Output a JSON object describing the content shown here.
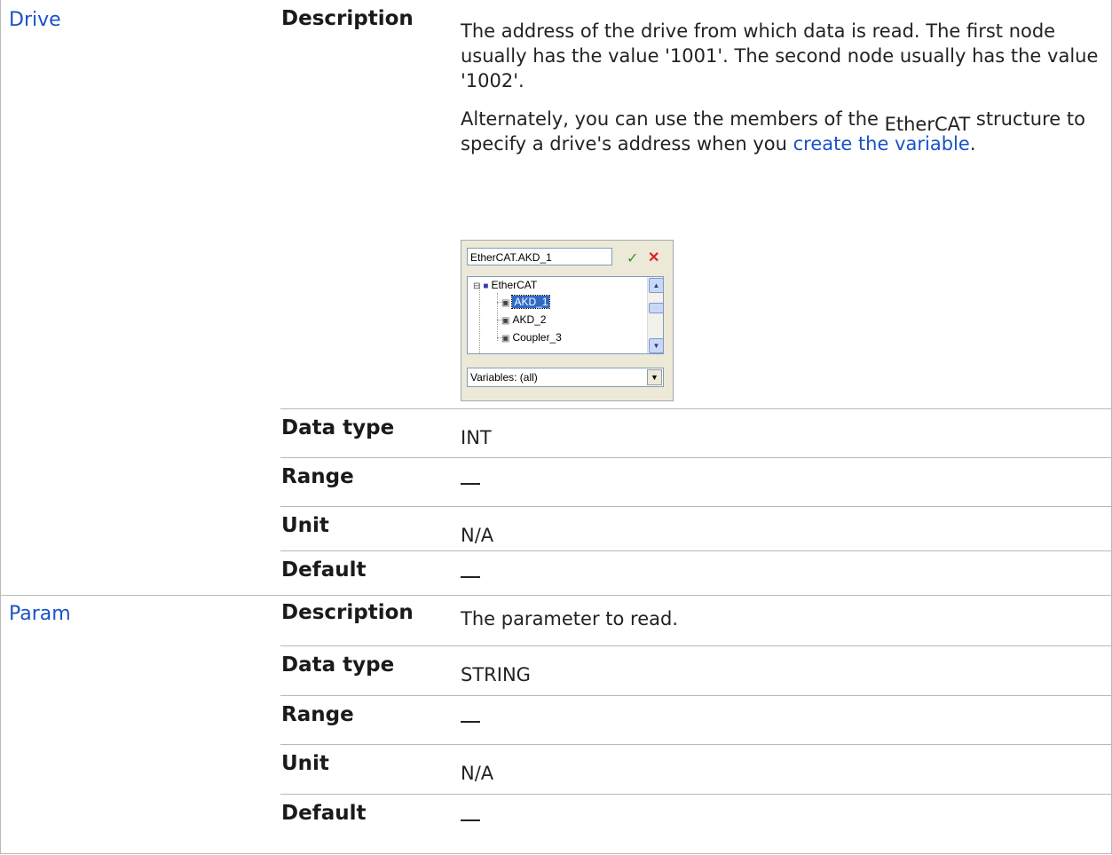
{
  "parameters": [
    {
      "name": "Drive",
      "description_label": "Description",
      "description_p1": "The address of the drive from which data is read. The first node usually has the value '1001'. The second node usually has the value '1002'.",
      "description_p2_pre": "Alternately, you can use the members of the ",
      "description_p2_sub": "EtherCAT",
      "description_p2_mid": " structure to specify a drive's address when you ",
      "description_p2_link": "create the variable",
      "description_p2_end": ".",
      "datatype_label": "Data type",
      "datatype": "INT",
      "range_label": "Range",
      "range": "—",
      "unit_label": "Unit",
      "unit": "N/A",
      "default_label": "Default",
      "default": "—"
    },
    {
      "name": "Param",
      "description_label": "Description",
      "description": "The parameter to read.",
      "datatype_label": "Data type",
      "datatype": "STRING",
      "range_label": "Range",
      "range": "—",
      "unit_label": "Unit",
      "unit": "N/A",
      "default_label": "Default",
      "default": "—"
    }
  ],
  "widget": {
    "input_value": "EtherCAT.AKD_1",
    "confirm_icon": "check-icon",
    "cancel_icon": "close-icon",
    "tree": [
      {
        "label": "EtherCAT",
        "icon": "folder-icon"
      },
      {
        "label": "AKD_1",
        "icon": "variable-icon",
        "selected": true
      },
      {
        "label": "AKD_2",
        "icon": "variable-icon"
      },
      {
        "label": "Coupler_3",
        "icon": "variable-icon"
      }
    ],
    "filter_value": "Variables: (all)"
  }
}
